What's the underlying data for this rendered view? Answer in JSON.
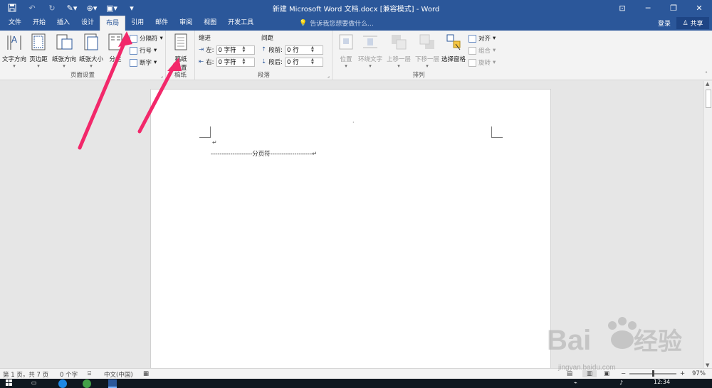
{
  "titlebar": {
    "title": "新建 Microsoft Word 文档.docx [兼容模式] - Word",
    "colors": {
      "accent": "#2b579a"
    }
  },
  "tabs": [
    "文件",
    "开始",
    "插入",
    "设计",
    "布局",
    "引用",
    "邮件",
    "审阅",
    "视图",
    "开发工具"
  ],
  "active_tab": "布局",
  "tell_me": "告诉我您想要做什么...",
  "login": "登录",
  "share": "共享",
  "ribbon": {
    "page_setup": {
      "label": "页面设置",
      "text_direction": "文字方向",
      "margins": "页边距",
      "orientation": "纸张方向",
      "size": "纸张大小",
      "columns": "分栏",
      "breaks": "分隔符",
      "line_numbers": "行号",
      "hyphenation": "断字"
    },
    "manuscript": {
      "label": "稿纸",
      "button_line1": "稿纸",
      "button_line2": "设置"
    },
    "paragraph": {
      "label": "段落",
      "indent": "缩进",
      "spacing": "间距",
      "left": "左:",
      "right": "右:",
      "before": "段前:",
      "after": "段后:",
      "left_value": "0 字符",
      "right_value": "0 字符",
      "before_value": "0 行",
      "after_value": "0 行"
    },
    "arrange": {
      "label": "排列",
      "position": "位置",
      "wrap_text": "环绕文字",
      "bring_forward": "上移一层",
      "send_backward": "下移一层",
      "selection_pane": "选择窗格",
      "align": "对齐",
      "group": "组合",
      "rotate": "旋转"
    }
  },
  "document": {
    "page_break_text": "-------------------分页符-------------------",
    "para_mark": "↵"
  },
  "statusbar": {
    "page": "第 1 页，共 7 页",
    "words": "0 个字",
    "language": "中文(中国)",
    "zoom": "97%"
  },
  "taskbar": {
    "time": "12:34"
  },
  "watermark": {
    "text": "Bai 经验",
    "sub": "jingyan.baidu.com"
  }
}
